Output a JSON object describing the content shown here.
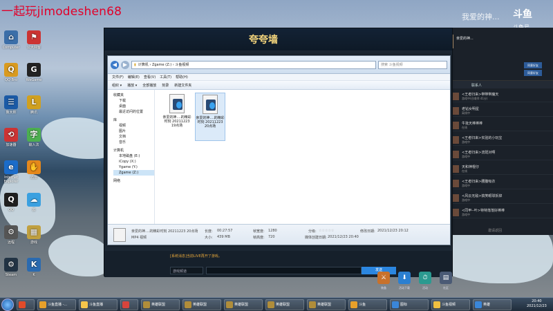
{
  "watermark": "一起玩jimodeshen68",
  "desktop_icons": [
    {
      "label": "Computer",
      "color": "#3b6ea8",
      "glyph": "⌂"
    },
    {
      "label": "公大网客",
      "color": "#cc3333",
      "glyph": "⚑"
    },
    {
      "label": "QQ Bro",
      "color": "#d99a1f",
      "glyph": "Q"
    },
    {
      "label": "WeGame",
      "color": "#222222",
      "glyph": "G"
    },
    {
      "label": "鲁大师",
      "color": "#1a5aa6",
      "glyph": "☰"
    },
    {
      "label": "腾讯",
      "color": "#d0a020",
      "glyph": "L"
    },
    {
      "label": "加速器",
      "color": "#c33",
      "glyph": "⟲"
    },
    {
      "label": "输入法",
      "color": "#4caf50",
      "glyph": "字"
    },
    {
      "label": "Internet Explorer",
      "color": "#1b6cc9",
      "glyph": "e"
    },
    {
      "label": "迅雷",
      "color": "#e5881b",
      "glyph": "✋"
    },
    {
      "label": "QQ",
      "color": "#1f1f1f",
      "glyph": "Q"
    },
    {
      "label": "云",
      "color": "#3aa0e0",
      "glyph": "☁"
    },
    {
      "label": "远程",
      "color": "#555555",
      "glyph": "⚙"
    },
    {
      "label": "游戏",
      "color": "#c0a040",
      "glyph": "▦"
    },
    {
      "label": "Steam",
      "color": "#234",
      "glyph": "⚙"
    },
    {
      "label": "K",
      "color": "#2a6ab0",
      "glyph": "K"
    }
  ],
  "game_window": {
    "title": "夸夸墙",
    "chat_hint": "[系统消息]当前LIVE再开了游戏。",
    "chat_channel": "游戏频道",
    "send_label": "发送"
  },
  "explorer": {
    "address": "计算机 › Zgame (Z:) › 斗鱼视频",
    "search_placeholder": "搜索 斗鱼视频",
    "menu": [
      "文件(F)",
      "编辑(E)",
      "查看(V)",
      "工具(T)",
      "帮助(H)"
    ],
    "toolbar": [
      "组织 ▾",
      "播放 ▾",
      "全部播放",
      "刻录",
      "新建文件夹"
    ],
    "nav": [
      {
        "label": "收藏夹",
        "sub": false
      },
      {
        "label": "下载",
        "sub": true
      },
      {
        "label": "桌面",
        "sub": true
      },
      {
        "label": "最近访问的位置",
        "sub": true
      },
      {
        "label": "库",
        "sub": false
      },
      {
        "label": "视频",
        "sub": true
      },
      {
        "label": "图片",
        "sub": true
      },
      {
        "label": "文档",
        "sub": true
      },
      {
        "label": "音乐",
        "sub": true
      },
      {
        "label": "计算机",
        "sub": false
      },
      {
        "label": "本地磁盘 (E:)",
        "sub": true
      },
      {
        "label": "iCopy (X:)",
        "sub": true
      },
      {
        "label": "Ygame (Y:)",
        "sub": true
      },
      {
        "label": "Zgame (Z:)",
        "sub": true
      },
      {
        "label": "网络",
        "sub": false
      }
    ],
    "files": [
      {
        "name": "亲爱的神....的精彩时刻 20211223 19点场"
      },
      {
        "name": "亲爱的神....的精彩时刻 20211223 20点场"
      }
    ],
    "details": {
      "filename": "亲爱的神....的精彩时刻 20211223 20点场",
      "type": "MP4 视频",
      "length_label": "长度:",
      "length": "00:27:57",
      "size_label": "大小:",
      "size": "439 MB",
      "framew_label": "帧宽度:",
      "framew": "1280",
      "frameh_label": "帧高度:",
      "frameh": "720",
      "rating_label": "分级:",
      "rating": "☆☆☆☆☆",
      "created_label": "媒体创建日期:",
      "created": "2021/12/23 20:40",
      "mod_label": "修改日期:",
      "mod": "2021/12/23 20:12"
    }
  },
  "right_panel": {
    "brand": "斗鱼",
    "stream_label": "斗鱼号",
    "stream_num": "7173916",
    "handwriting": "我爱的神...",
    "user": "亲爱的神...",
    "tab": "联系人",
    "btn1": "同意好友",
    "btn2": "同意好友",
    "footer": "邀请返回",
    "contacts": [
      {
        "name": "<王者归来>带带带魔天",
        "status": "游戏中(召唤师 41分)"
      },
      {
        "name": "老钻女明星",
        "status": "离线中"
      },
      {
        "name": "牛批天棒棒棒",
        "status": "在线"
      },
      {
        "name": "<王者归来>实验的小玩宝",
        "status": "游戏中"
      },
      {
        "name": "<王者归来>流斑对啊",
        "status": "游戏中"
      },
      {
        "name": "天和神棍仔",
        "status": "在线"
      },
      {
        "name": "<王者归来>腰腹吸衣",
        "status": "游戏中"
      },
      {
        "name": "<风云无敌>搞笑眼球拆掉",
        "status": "游戏中"
      },
      {
        "name": "<同甲--叶>特特落落好棒棒",
        "status": "游戏中"
      }
    ]
  },
  "game_buttons": [
    {
      "label": "装备",
      "glyph": "⚔",
      "color": "#c8712b"
    },
    {
      "label": "活动下载",
      "glyph": "⬇",
      "color": "#2b7fd0"
    },
    {
      "label": "活动",
      "glyph": "⏱",
      "color": "#2b9a90"
    },
    {
      "label": "社区",
      "glyph": "▤",
      "color": "#4a5a75"
    }
  ],
  "taskbar": [
    {
      "label": "",
      "color": "#e14b2a"
    },
    {
      "label": "斗鱼直播 -...",
      "color": "#e8a02a"
    },
    {
      "label": "斗鱼直播",
      "color": "#f5c54a"
    },
    {
      "label": "",
      "color": "#d6443c"
    },
    {
      "label": "英雄联盟",
      "color": "#b08d3a"
    },
    {
      "label": "英雄联盟",
      "color": "#b08d3a"
    },
    {
      "label": "英雄联盟",
      "color": "#b08d3a"
    },
    {
      "label": "英雄联盟",
      "color": "#b08d3a"
    },
    {
      "label": "英雄联盟",
      "color": "#b08d3a"
    },
    {
      "label": "斗鱼",
      "color": "#e8a02a"
    },
    {
      "label": "图标",
      "color": "#3a86d8"
    },
    {
      "label": "斗鱼视频",
      "color": "#f0c040"
    },
    {
      "label": "英雄",
      "color": "#3a86d8"
    }
  ],
  "clock": {
    "time": "20:40",
    "date": "2021/12/23"
  }
}
